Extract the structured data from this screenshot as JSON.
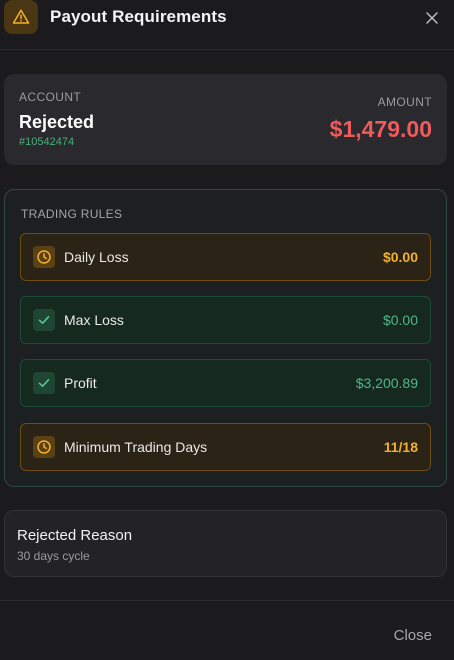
{
  "header": {
    "title": "Payout Requirements",
    "icon": "warning-triangle-icon",
    "close_icon": "close-icon"
  },
  "account": {
    "label": "ACCOUNT",
    "status": "Rejected",
    "id": "#10542474",
    "amount_label": "AMOUNT",
    "amount": "$1,479.00"
  },
  "rules": {
    "title": "TRADING RULES",
    "items": [
      {
        "name": "Daily Loss",
        "value": "$0.00",
        "state": "pending",
        "icon": "clock-icon"
      },
      {
        "name": "Max Loss",
        "value": "$0.00",
        "state": "passed",
        "icon": "check-icon"
      },
      {
        "name": "Profit",
        "value": "$3,200.89",
        "state": "passed",
        "icon": "check-icon"
      },
      {
        "name": "Minimum Trading Days",
        "value": "11/18",
        "state": "pending",
        "icon": "clock-icon"
      }
    ]
  },
  "reason": {
    "title": "Rejected Reason",
    "subtitle": "30 days cycle"
  },
  "footer": {
    "close_label": "Close"
  },
  "colors": {
    "warning": "#f2b02e",
    "success": "#4fb787",
    "danger": "#ef5b5b"
  }
}
